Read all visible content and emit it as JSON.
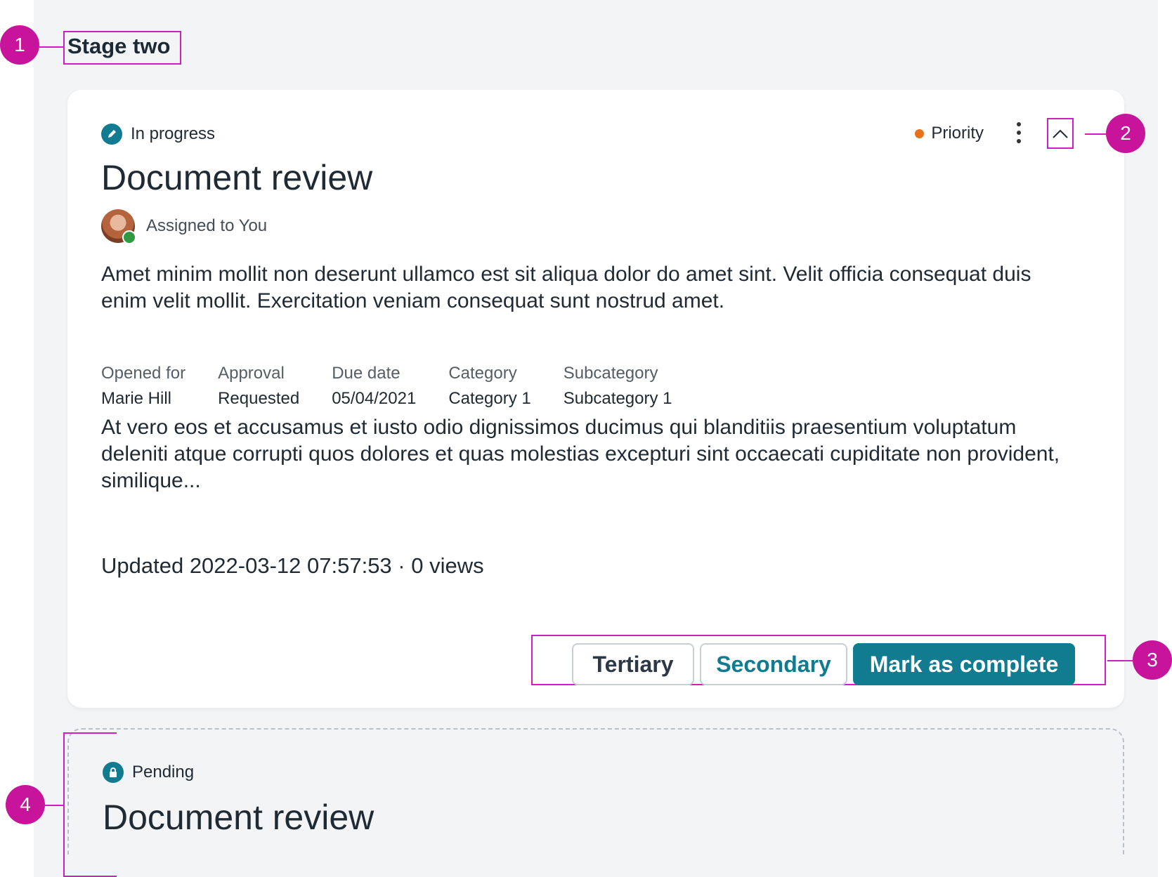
{
  "stage": {
    "title": "Stage two"
  },
  "card": {
    "status": "In progress",
    "status_icon": "edit-icon",
    "title": "Document review",
    "assignee": "Assigned to You",
    "priority": "Priority",
    "priority_color": "#e7711b",
    "description": "Amet minim mollit non deserunt ullamco est sit aliqua dolor do amet sint. Velit officia consequat duis enim velit mollit. Exercitation veniam consequat sunt nostrud amet.",
    "meta": [
      {
        "label": "Opened for",
        "value": "Marie Hill"
      },
      {
        "label": "Approval",
        "value": "Requested"
      },
      {
        "label": "Due date",
        "value": "05/04/2021"
      },
      {
        "label": "Category",
        "value": "Category 1"
      },
      {
        "label": "Subcategory",
        "value": "Subcategory 1"
      }
    ],
    "details": "At vero eos et accusamus et iusto odio dignissimos ducimus qui blanditiis praesentium voluptatum deleniti atque corrupti quos dolores et quas molestias excepturi sint occaecati cupiditate non provident, similique...",
    "updated": "Updated 2022-03-12 07:57:53 · 0 views",
    "buttons": {
      "tertiary": "Tertiary",
      "secondary": "Secondary",
      "primary": "Mark as complete"
    }
  },
  "pending_card": {
    "status": "Pending",
    "status_icon": "lock-icon",
    "title": "Document review"
  },
  "annotations": [
    "1",
    "2",
    "3",
    "4"
  ],
  "colors": {
    "accent": "#117b8f",
    "annotation": "#c8149b",
    "success": "#2f9a41"
  }
}
